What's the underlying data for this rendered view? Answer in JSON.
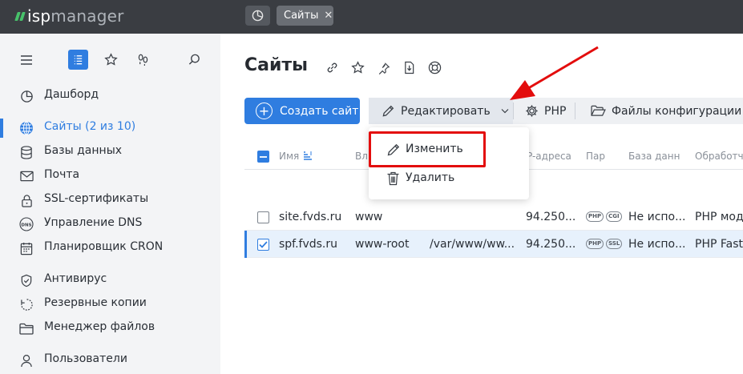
{
  "app": {
    "logo_part1": "isp",
    "logo_part2": "manager"
  },
  "tabs": [
    {
      "label": "Сайты",
      "close": "✕"
    }
  ],
  "sidebar": {
    "items": [
      {
        "label": "Дашборд",
        "icon": "dashboard-icon"
      },
      {
        "label": "Сайты (2 из 10)",
        "icon": "globe-icon",
        "active": true
      },
      {
        "label": "Базы данных",
        "icon": "database-icon"
      },
      {
        "label": "Почта",
        "icon": "mail-icon"
      },
      {
        "label": "SSL-сертификаты",
        "icon": "lock-icon"
      },
      {
        "label": "Управление DNS",
        "icon": "dns-icon"
      },
      {
        "label": "Планировщик CRON",
        "icon": "calendar-icon"
      },
      {
        "label": "Антивирус",
        "icon": "shield-icon"
      },
      {
        "label": "Резервные копии",
        "icon": "backup-icon"
      },
      {
        "label": "Менеджер файлов",
        "icon": "folder-icon"
      },
      {
        "label": "Пользователи",
        "icon": "user-icon"
      }
    ]
  },
  "page": {
    "title": "Сайты"
  },
  "toolbar": {
    "create_label": "Создать сайт",
    "edit_label": "Редактировать",
    "php_label": "PHP",
    "config_label": "Файлы конфигурации"
  },
  "dropdown": {
    "edit_item": "Изменить",
    "delete_item": "Удалить"
  },
  "table": {
    "columns": [
      "Имя",
      "Вл",
      "P-адреса",
      "Пар",
      "База данн",
      "Обработч"
    ],
    "rows": [
      {
        "name": "site.fvds.ru",
        "owner": "www",
        "path": "",
        "ip": "94.250...",
        "badges": [
          "PHP",
          "CGI"
        ],
        "db": "Не испо...",
        "handler": "PHP моду",
        "checked": false,
        "selected": false
      },
      {
        "name": "spf.fvds.ru",
        "owner": "www-root",
        "path": "/var/www/ww...",
        "ip": "94.250...",
        "badges": [
          "PHP",
          "SSL"
        ],
        "db": "Не испо...",
        "handler": "PHP FastC",
        "checked": true,
        "selected": true
      }
    ]
  },
  "colors": {
    "accent": "#2f7de0",
    "topbar": "#3a3d42",
    "sidebar": "#f3f4f6",
    "annotation": "#e30d0d"
  }
}
